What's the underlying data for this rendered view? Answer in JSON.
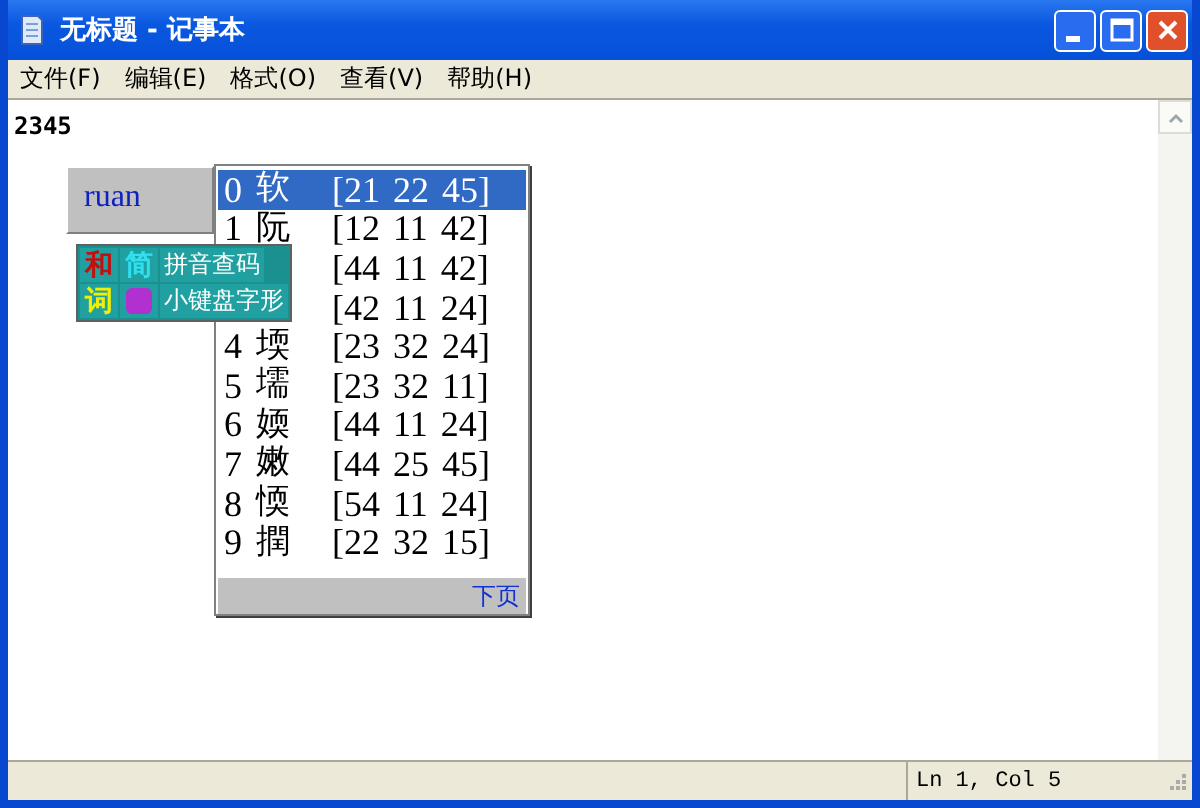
{
  "window": {
    "title": "无标题 - 记事本"
  },
  "menu": [
    "文件(F)",
    "编辑(E)",
    "格式(O)",
    "查看(V)",
    "帮助(H)"
  ],
  "document": {
    "text": "2345"
  },
  "ime": {
    "composition": "ruan",
    "candidates": [
      {
        "index": "0",
        "char": "软",
        "code": "[21 22 45]",
        "selected": true
      },
      {
        "index": "1",
        "char": "阮",
        "code": "[12 11 42]",
        "selected": false
      },
      {
        "code": "[44 11 42]",
        "selected": false
      },
      {
        "code": "[42 11 24]",
        "selected": false
      },
      {
        "index": "4",
        "char": "堧",
        "code": "[23 32 24]",
        "selected": false
      },
      {
        "index": "5",
        "char": "壖",
        "code": "[23 32 11]",
        "selected": false
      },
      {
        "index": "6",
        "char": "媆",
        "code": "[44 11 24]",
        "selected": false
      },
      {
        "index": "7",
        "char": "嫩",
        "code": "[44 25 45]",
        "selected": false
      },
      {
        "index": "8",
        "char": "愞",
        "code": "[54 11 24]",
        "selected": false
      },
      {
        "index": "9",
        "char": "撋",
        "code": "[22 32 15]",
        "selected": false
      }
    ],
    "next_page": "下页",
    "status_rows": [
      [
        {
          "text": "和",
          "color": "#c01010"
        },
        {
          "text": "简",
          "color": "#30e0f0"
        },
        {
          "text": "拼音查码",
          "color": "#ffffff"
        }
      ],
      [
        {
          "text": "词",
          "color": "#f0f000"
        },
        {
          "color": "#b030d0"
        },
        {
          "text": "小键盘字形",
          "color": "#ffffff"
        }
      ]
    ]
  },
  "status_bar": {
    "position": "Ln 1, Col 5"
  }
}
